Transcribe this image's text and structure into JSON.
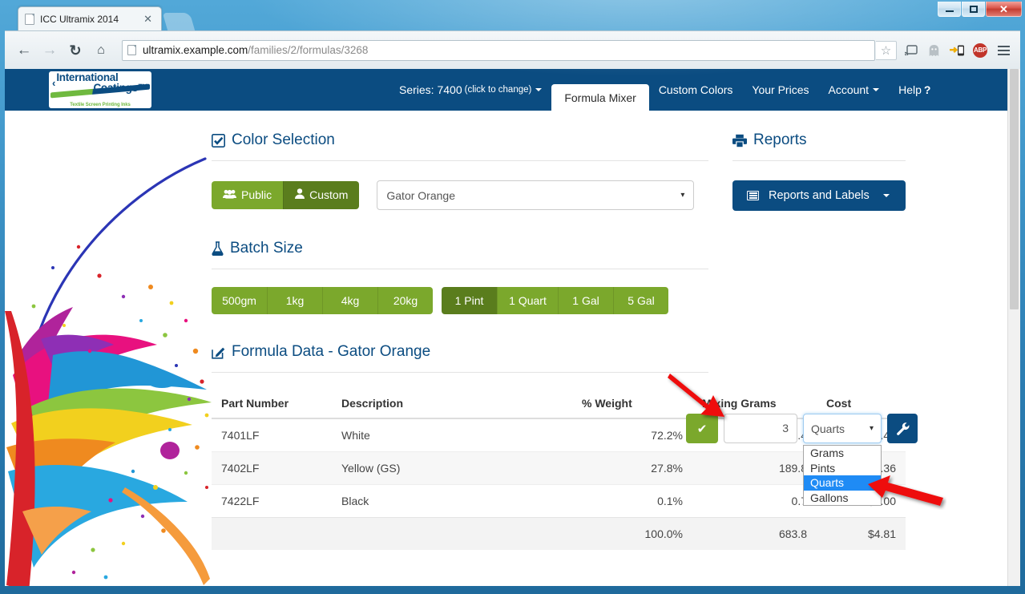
{
  "window": {
    "minimize_label": "minimize",
    "maximize_label": "maximize",
    "close_label": "✕"
  },
  "browser": {
    "tab": {
      "title": "ICC Ultramix 2014",
      "close_label": "✕"
    },
    "back_label": "←",
    "forward_label": "→",
    "reload_label": "↻",
    "home_label": "⌂",
    "url_host": "ultramix.example.com",
    "url_path": "/families/2/formulas/3268",
    "bookmark_label": "☆",
    "extensions": [
      {
        "name": "cast-icon",
        "glyph": "▭"
      },
      {
        "name": "ghostery-icon",
        "glyph": "☺"
      },
      {
        "name": "send-to-phone-icon",
        "glyph": "→"
      },
      {
        "name": "adblock-plus-icon",
        "glyph": "ABP"
      }
    ],
    "menu_label": "menu"
  },
  "app": {
    "logo": {
      "chevron": "‹",
      "line1": "International",
      "line2": "Coatings™",
      "tagline": "Textile Screen Printing Inks"
    },
    "nav": [
      {
        "label": "Series: 7400",
        "sub": "(click to change)",
        "caret": true,
        "active": false
      },
      {
        "label": "Formula Mixer",
        "sub": "",
        "caret": false,
        "active": true
      },
      {
        "label": "Custom Colors",
        "sub": "",
        "caret": false,
        "active": false
      },
      {
        "label": "Your Prices",
        "sub": "",
        "caret": false,
        "active": false
      },
      {
        "label": "Account",
        "sub": "",
        "caret": true,
        "active": false
      },
      {
        "label": "Help",
        "sub": "",
        "caret": false,
        "active": false,
        "suffix": "?"
      }
    ]
  },
  "color_selection": {
    "heading": "Color Selection",
    "heading_icon": "☑",
    "public_label": "Public",
    "custom_label": "Custom",
    "selected_color": "Gator Orange",
    "dropdown_caret": "▾"
  },
  "reports": {
    "heading": "Reports",
    "heading_icon": "⎙",
    "button_label": "Reports and Labels",
    "button_caret": "▾"
  },
  "batch_size": {
    "heading": "Batch Size",
    "heading_icon": "⚗",
    "metric_options": [
      "500gm",
      "1kg",
      "4kg",
      "20kg"
    ],
    "imperial_options": [
      "1 Pint",
      "1 Quart",
      "1 Gal",
      "5 Gal"
    ],
    "active_option": "1 Pint",
    "confirm_label": "✔",
    "quantity_value": "3",
    "quantity_placeholder": "",
    "unit_value": "Quarts",
    "unit_caret": "▾",
    "unit_options": [
      "Grams",
      "Pints",
      "Quarts",
      "Gallons"
    ],
    "unit_selected": "Quarts",
    "settings_label": "🔧"
  },
  "formula": {
    "heading": "Formula Data - Gator Orange",
    "heading_icon": "✎",
    "columns": [
      "Part Number",
      "Description",
      "% Weight",
      "Mixing Grams",
      "Cost"
    ],
    "rows": [
      {
        "part": "7401LF",
        "desc": "White",
        "weight": "72.2%",
        "grams": "493.4",
        "cost": "$3.45"
      },
      {
        "part": "7402LF",
        "desc": "Yellow (GS)",
        "weight": "27.8%",
        "grams": "189.8",
        "cost": "$1.36"
      },
      {
        "part": "7422LF",
        "desc": "Black",
        "weight": "0.1%",
        "grams": "0.7",
        "cost": "$0.00"
      }
    ],
    "total": {
      "part": "",
      "desc": "",
      "weight": "100.0%",
      "grams": "683.8",
      "cost": "$4.81"
    }
  },
  "annotations": {
    "arrow1_name": "arrow-pointing-to-quantity-input",
    "arrow2_name": "arrow-pointing-to-unit-options",
    "color": "#ee1111"
  },
  "colors": {
    "header_blue": "#0b4c81",
    "green": "#7ba82c",
    "green_dark": "#5a7d1d",
    "highlight_blue": "#1f8bf5"
  }
}
